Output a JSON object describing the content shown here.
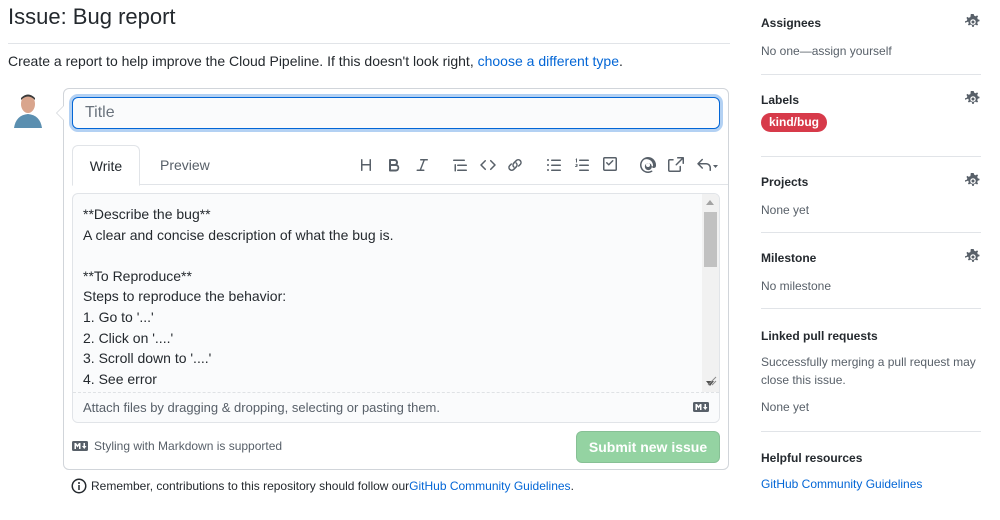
{
  "page": {
    "title": "Issue: Bug report",
    "intro_text": "Create a report to help improve the Cloud Pipeline. If this doesn't look right, ",
    "intro_link": "choose a different type",
    "intro_end": "."
  },
  "form": {
    "title_placeholder": "Title",
    "tabs": [
      "Write",
      "Preview"
    ],
    "toolbar_icons": [
      "header-icon",
      "bold-icon",
      "italic-icon",
      "quote-icon",
      "code-icon",
      "link-icon",
      "unordered-list-icon",
      "ordered-list-icon",
      "task-list-icon",
      "mention-icon",
      "reference-icon",
      "reply-icon"
    ],
    "body_text": "**Describe the bug**\nA clear and concise description of what the bug is.\n\n**To Reproduce**\nSteps to reproduce the behavior:\n1. Go to '...'\n2. Click on '....'\n3. Scroll down to '....'\n4. See error",
    "attach_text": "Attach files by dragging & dropping, selecting or pasting them.",
    "markdown_hint": "Styling with Markdown is supported",
    "submit_label": "Submit new issue",
    "footer_prefix": "Remember, contributions to this repository should follow our ",
    "footer_link": "GitHub Community Guidelines",
    "footer_suffix": "."
  },
  "sidebar": {
    "assignees": {
      "heading": "Assignees",
      "body": "No one—assign yourself"
    },
    "labels": {
      "heading": "Labels",
      "badge": "kind/bug",
      "badge_color": "#d73a4a"
    },
    "projects": {
      "heading": "Projects",
      "body": "None yet"
    },
    "milestone": {
      "heading": "Milestone",
      "body": "No milestone"
    },
    "linked_prs": {
      "heading": "Linked pull requests",
      "body": "Successfully merging a pull request may close this issue.",
      "body2": "None yet"
    },
    "helpful": {
      "heading": "Helpful resources",
      "link": "GitHub Community Guidelines"
    }
  },
  "colors": {
    "link": "#0366d6",
    "submit_disabled": "#94d3a2",
    "label_red": "#d73a4a"
  }
}
